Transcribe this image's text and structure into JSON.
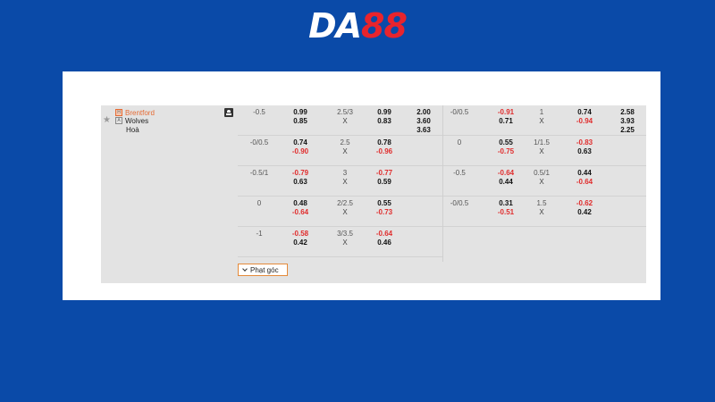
{
  "brand": {
    "part1": "DA",
    "part2": "88"
  },
  "match": {
    "home": "Brentford",
    "away": "Wolves",
    "draw": "Hoà",
    "home_badge": "H",
    "away_badge": "A"
  },
  "half1": [
    {
      "hdp": "-0.5",
      "h1": "0.99",
      "h2": "0.85",
      "ou": "2.5/3",
      "o1": "0.99",
      "o2": "0.83",
      "x1": [
        "2.00",
        "3.60",
        "3.63"
      ]
    },
    {
      "hdp": "-0/0.5",
      "h1": "0.74",
      "h2": "-0.90",
      "ou": "2.5",
      "o1": "0.78",
      "o2": "-0.96",
      "x1": []
    },
    {
      "hdp": "-0.5/1",
      "h1": "-0.79",
      "h2": "0.63",
      "ou": "3",
      "o1": "-0.77",
      "o2": "0.59",
      "x1": []
    },
    {
      "hdp": "0",
      "h1": "0.48",
      "h2": "-0.64",
      "ou": "2/2.5",
      "o1": "0.55",
      "o2": "-0.73",
      "x1": []
    },
    {
      "hdp": "-1",
      "h1": "-0.58",
      "h2": "0.42",
      "ou": "3/3.5",
      "o1": "-0.64",
      "o2": "0.46",
      "x1": []
    }
  ],
  "half2": [
    {
      "hdp": "-0/0.5",
      "h1": "-0.91",
      "h2": "0.71",
      "ou": "1",
      "o1": "0.74",
      "o2": "-0.94",
      "x1": [
        "2.58",
        "3.93",
        "2.25"
      ]
    },
    {
      "hdp": "0",
      "h1": "0.55",
      "h2": "-0.75",
      "ou": "1/1.5",
      "o1": "-0.83",
      "o2": "0.63",
      "x1": []
    },
    {
      "hdp": "-0.5",
      "h1": "-0.64",
      "h2": "0.44",
      "ou": "0.5/1",
      "o1": "0.44",
      "o2": "-0.64",
      "x1": []
    },
    {
      "hdp": "-0/0.5",
      "h1": "0.31",
      "h2": "-0.51",
      "ou": "1.5",
      "o1": "-0.62",
      "o2": "0.42",
      "x1": []
    }
  ],
  "x_label": "X",
  "corner_button": "Phạt góc",
  "colors": {
    "background": "#0a4aa8",
    "negative": "#e02d2d",
    "home": "#e56a33",
    "brand_red": "#e8242d"
  }
}
